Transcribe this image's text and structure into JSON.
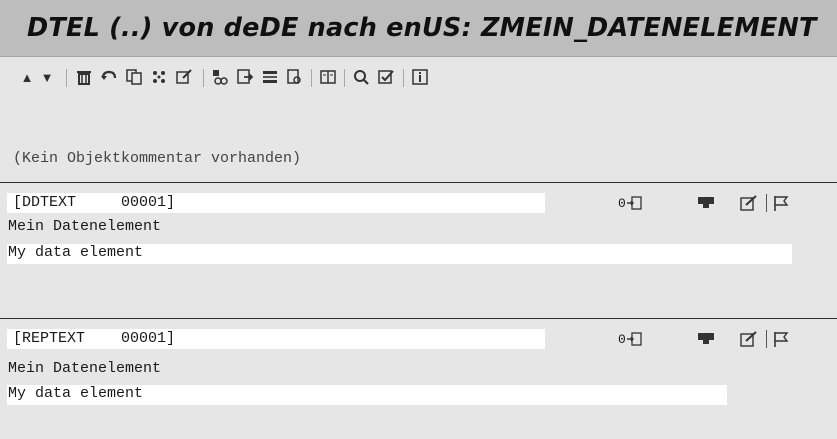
{
  "title": "DTEL (..) von deDE nach enUS: ZMEIN_DATENELEMENT",
  "toolbar": {
    "icons": [
      "arrow-up-icon",
      "arrow-down-icon",
      "delete-icon",
      "undo-icon",
      "copy-icon",
      "proposal-icon",
      "edit-icon",
      "text-icon",
      "insert-icon",
      "format-icon",
      "search-text-icon",
      "split-view-icon",
      "zoom-icon",
      "check-icon",
      "info-icon"
    ]
  },
  "comment": "(Kein Objektkommentar vorhanden)",
  "blocks": [
    {
      "header": "[DDTEXT     00001]",
      "counter": "0",
      "source": "Mein Datenelement",
      "target": "My data element"
    },
    {
      "header": "[REPTEXT    00001]",
      "counter": "0",
      "source": "Mein Datenelement",
      "target": "My data element"
    }
  ]
}
